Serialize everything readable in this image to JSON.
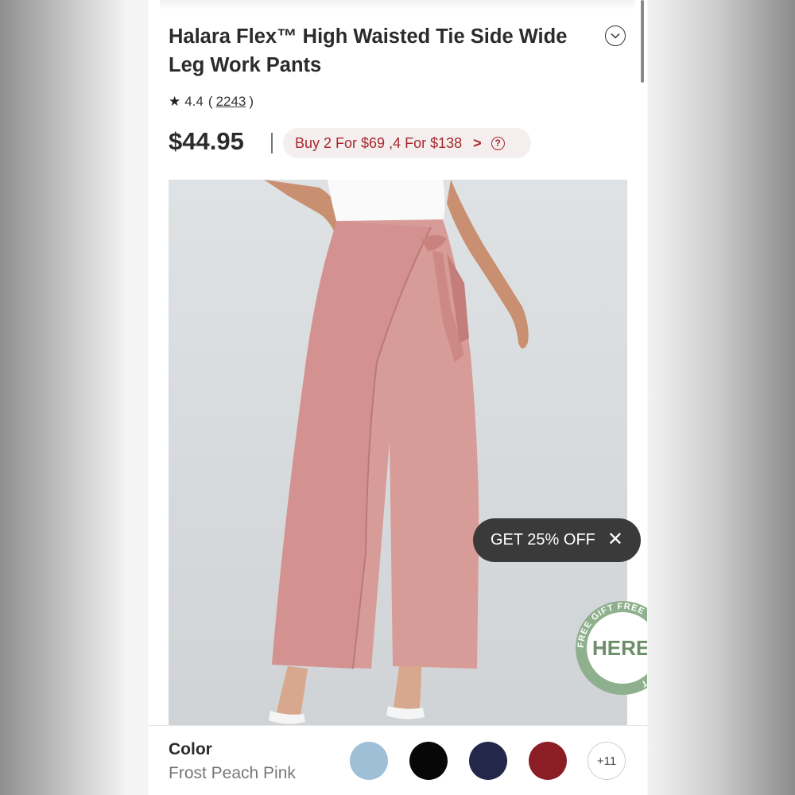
{
  "product": {
    "title": "Halara Flex™ High Waisted Tie Side Wide Leg Work Pants",
    "rating_value": "4.4",
    "rating_open": "(",
    "review_count": "2243",
    "rating_close": ")",
    "price": "$44.95",
    "promo_text": "Buy 2 For $69 ,4 For $138",
    "promo_arrow": ">",
    "promo_help": "?"
  },
  "overlay": {
    "coupon_text": "GET 25% OFF",
    "coupon_close": "✕",
    "gift_badge_main": "HERE",
    "gift_ring_text": "FREE GIFT FREE GIFT FREE GIFT"
  },
  "color_selector": {
    "label": "Color",
    "selected_value": "Frost Peach Pink",
    "swatches": [
      {
        "name": "light blue",
        "color": "#9fbfd6"
      },
      {
        "name": "black",
        "color": "#070707"
      },
      {
        "name": "navy",
        "color": "#23284a"
      },
      {
        "name": "burgundy",
        "color": "#8b1d25"
      }
    ],
    "more_label": "+11"
  },
  "colors": {
    "accent_red": "#a8282d",
    "pants_pink": "#d89c98"
  },
  "icons": {
    "star": "star-icon",
    "chevron_down": "chevron-down-icon",
    "close": "close-icon",
    "help": "question-circle-icon"
  }
}
